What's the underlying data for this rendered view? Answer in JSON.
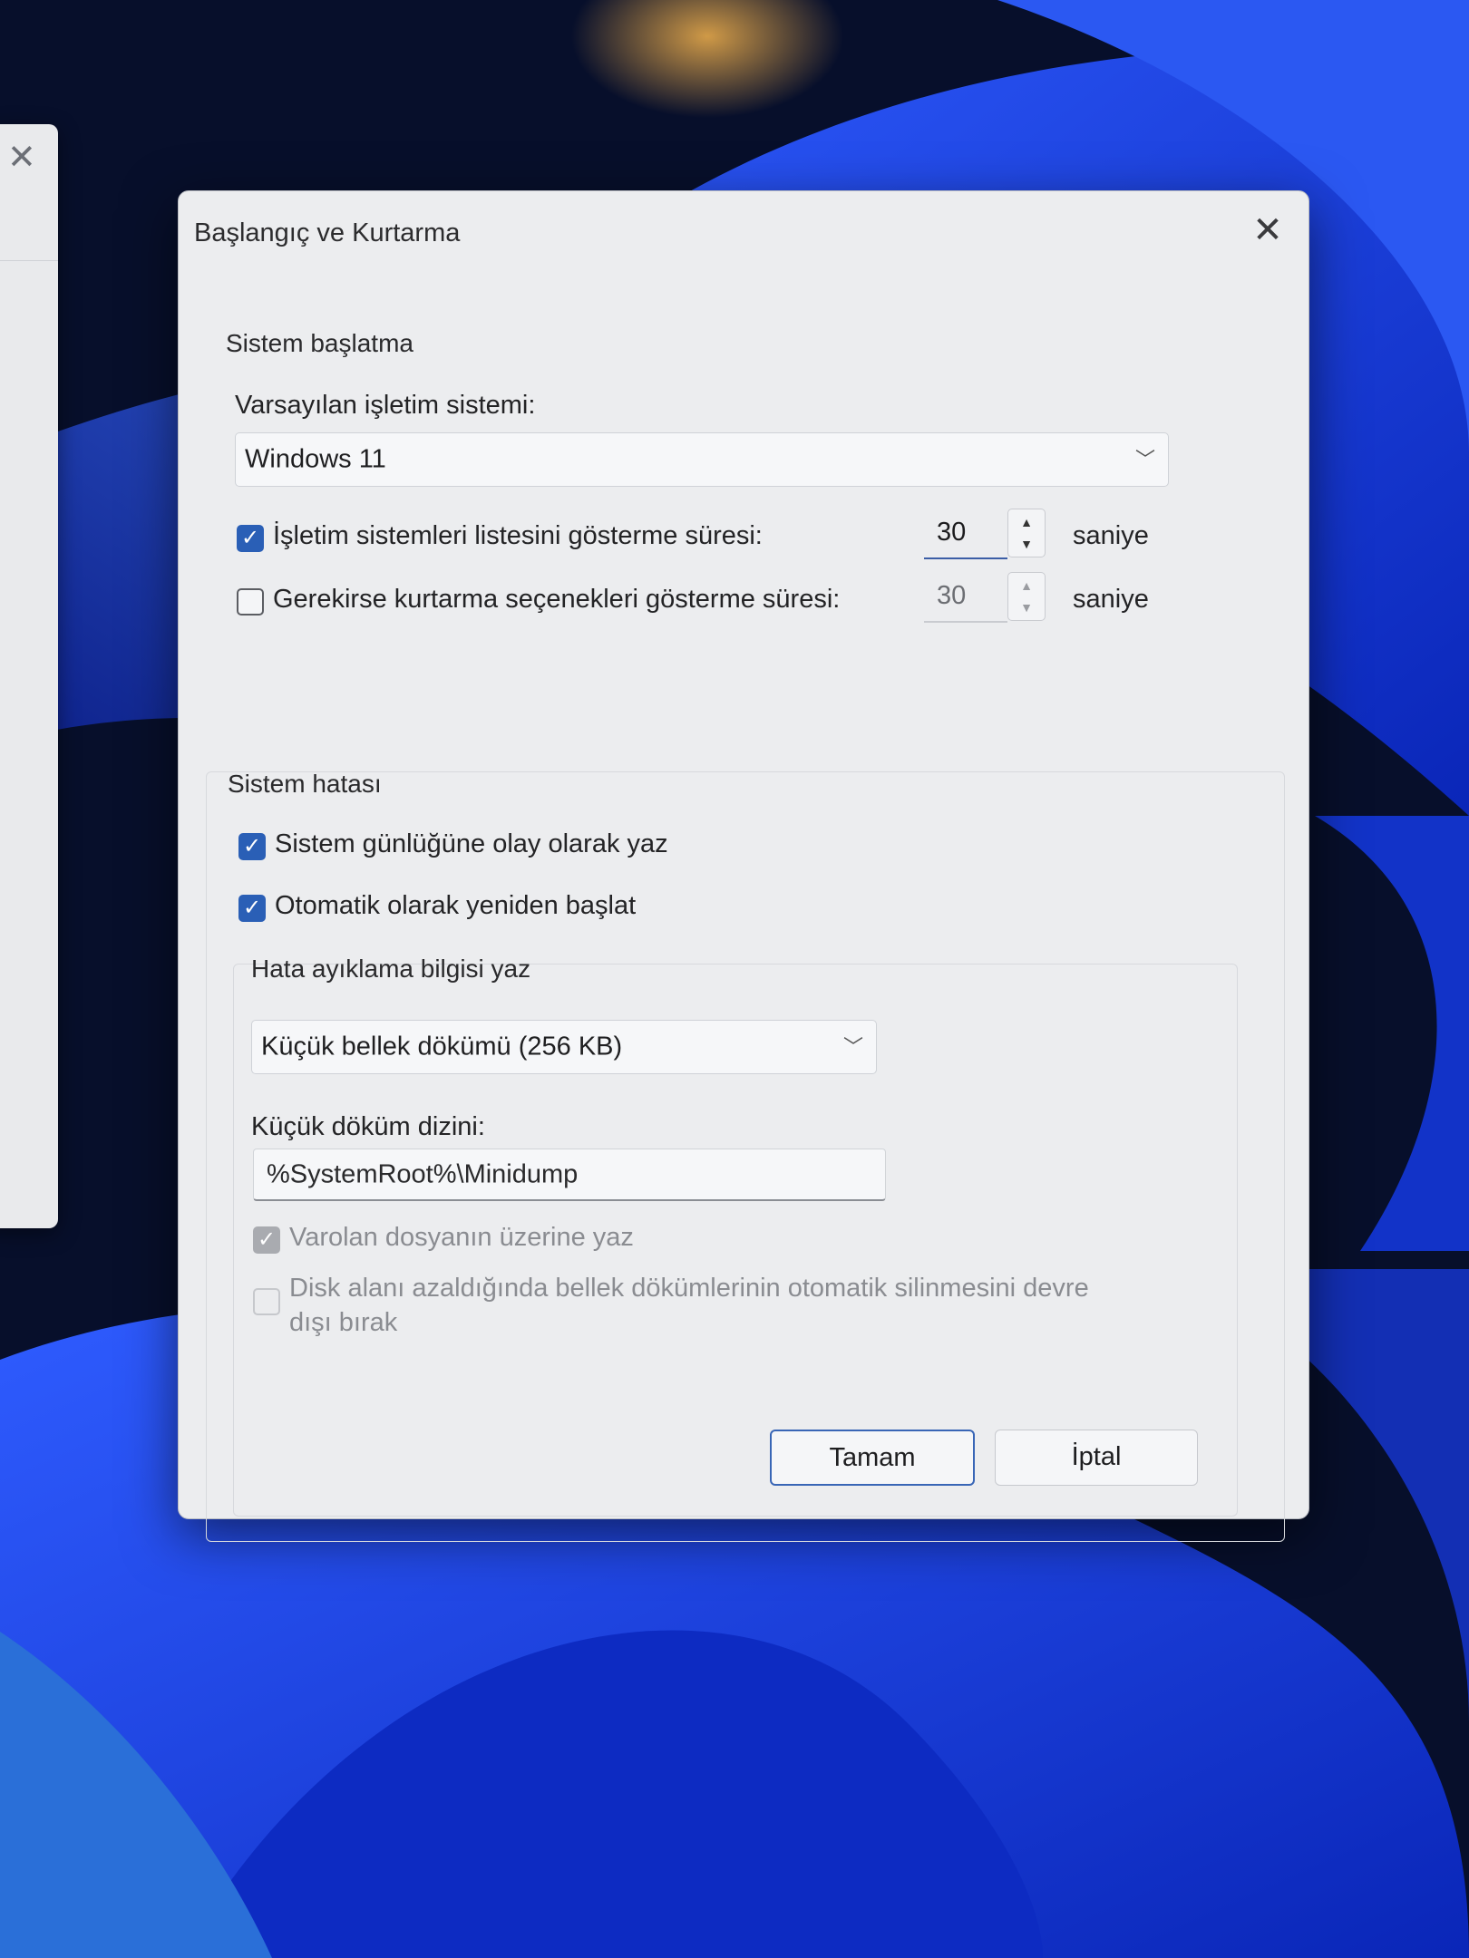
{
  "dialog": {
    "title": "Başlangıç ve Kurtarma"
  },
  "startup": {
    "legend": "Sistem başlatma",
    "default_os_label": "Varsayılan işletim sistemi:",
    "default_os_value": "Windows 11",
    "show_os_list": {
      "label": "İşletim sistemleri listesini gösterme süresi:",
      "checked": true,
      "value": "30",
      "unit": "saniye"
    },
    "show_recovery": {
      "label": "Gerekirse kurtarma seçenekleri gösterme süresi:",
      "checked": false,
      "value": "30",
      "unit": "saniye"
    }
  },
  "failure": {
    "legend": "Sistem hatası",
    "write_event": {
      "label": "Sistem günlüğüne olay olarak yaz",
      "checked": true
    },
    "auto_restart": {
      "label": "Otomatik olarak yeniden başlat",
      "checked": true
    },
    "debug_legend": "Hata ayıklama bilgisi yaz",
    "dump_type_value": "Küçük bellek dökümü (256 KB)",
    "dump_dir_label": "Küçük döküm dizini:",
    "dump_dir_value": "%SystemRoot%\\Minidump",
    "overwrite": {
      "label": "Varolan dosyanın üzerine yaz",
      "checked": true,
      "disabled": true
    },
    "disable_auto_delete": {
      "label_line1": "Disk alanı azaldığında bellek dökümlerinin otomatik silinmesini devre",
      "label_line2": "dışı bırak",
      "checked": false,
      "disabled": true
    }
  },
  "buttons": {
    "ok": "Tamam",
    "cancel": "İptal"
  },
  "colors": {
    "accent": "#2a5fb6",
    "dialog_bg": "#ecedef",
    "wallpaper": "#1840d8"
  }
}
